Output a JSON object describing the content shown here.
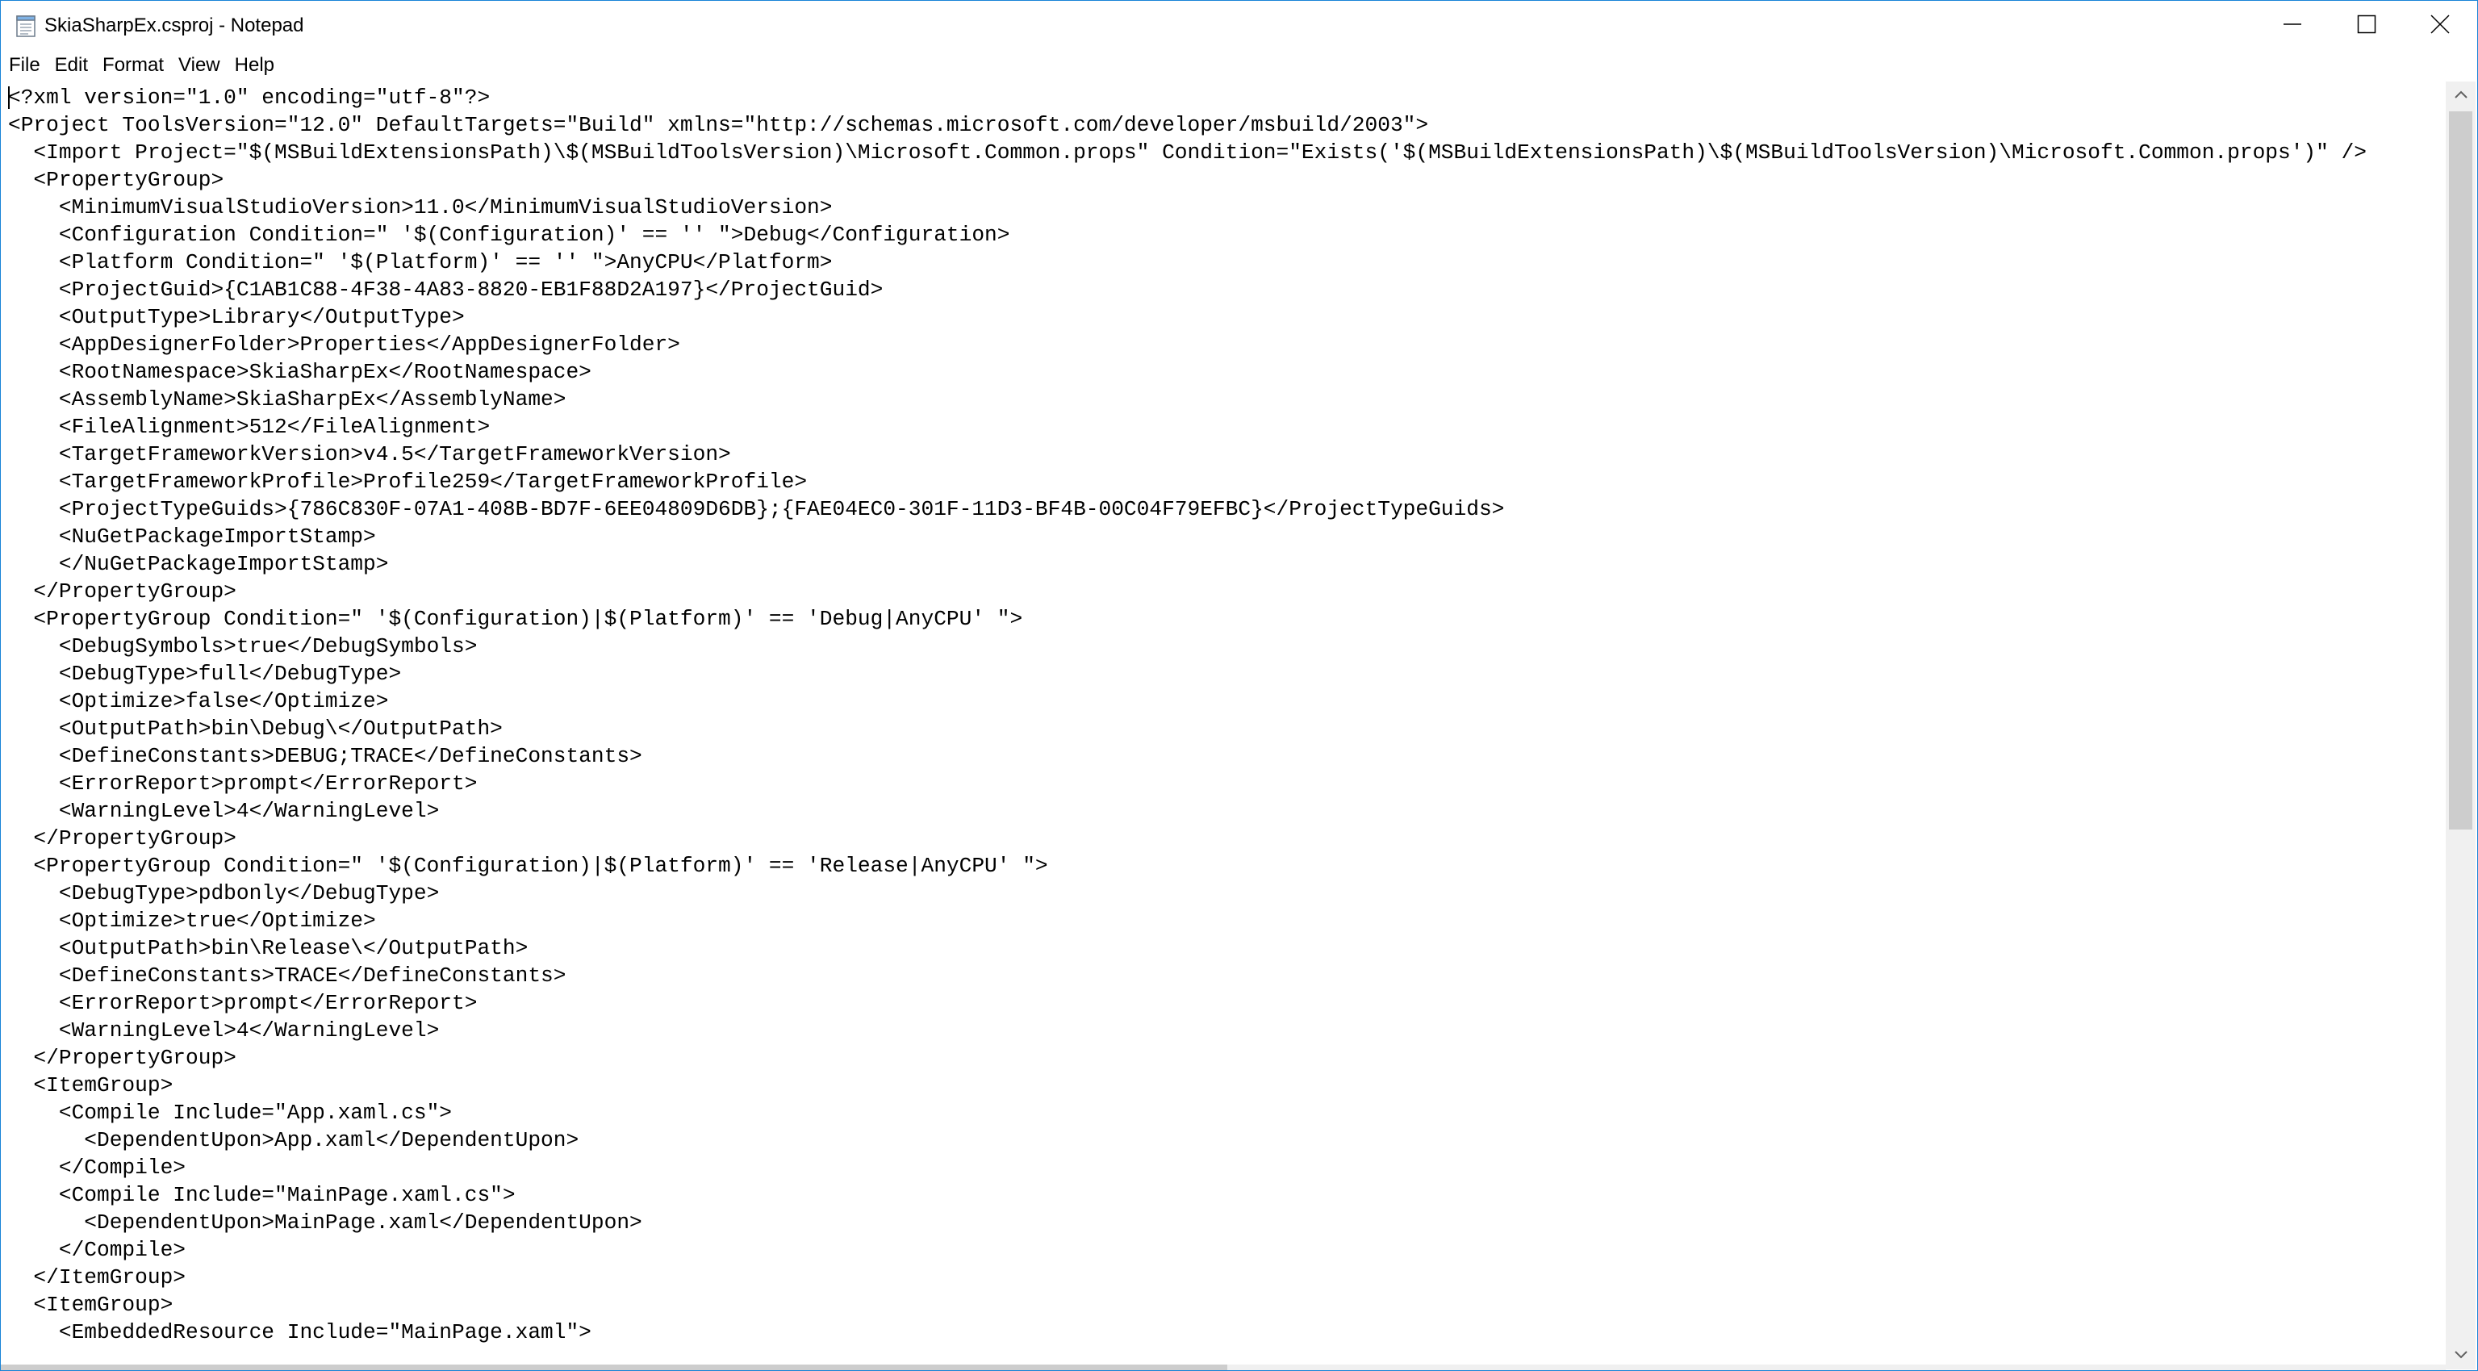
{
  "window": {
    "title": "SkiaSharpEx.csproj - Notepad",
    "app_icon": "notepad-icon",
    "controls": [
      "minimize-icon",
      "maximize-icon",
      "close-icon"
    ]
  },
  "menu": {
    "items": [
      {
        "label": "File"
      },
      {
        "label": "Edit"
      },
      {
        "label": "Format"
      },
      {
        "label": "View"
      },
      {
        "label": "Help"
      }
    ]
  },
  "editor": {
    "lines": [
      "<?xml version=\"1.0\" encoding=\"utf-8\"?>",
      "<Project ToolsVersion=\"12.0\" DefaultTargets=\"Build\" xmlns=\"http://schemas.microsoft.com/developer/msbuild/2003\">",
      "  <Import Project=\"$(MSBuildExtensionsPath)\\$(MSBuildToolsVersion)\\Microsoft.Common.props\" Condition=\"Exists('$(MSBuildExtensionsPath)\\$(MSBuildToolsVersion)\\Microsoft.Common.props')\" />",
      "  <PropertyGroup>",
      "    <MinimumVisualStudioVersion>11.0</MinimumVisualStudioVersion>",
      "    <Configuration Condition=\" '$(Configuration)' == '' \">Debug</Configuration>",
      "    <Platform Condition=\" '$(Platform)' == '' \">AnyCPU</Platform>",
      "    <ProjectGuid>{C1AB1C88-4F38-4A83-8820-EB1F88D2A197}</ProjectGuid>",
      "    <OutputType>Library</OutputType>",
      "    <AppDesignerFolder>Properties</AppDesignerFolder>",
      "    <RootNamespace>SkiaSharpEx</RootNamespace>",
      "    <AssemblyName>SkiaSharpEx</AssemblyName>",
      "    <FileAlignment>512</FileAlignment>",
      "    <TargetFrameworkVersion>v4.5</TargetFrameworkVersion>",
      "    <TargetFrameworkProfile>Profile259</TargetFrameworkProfile>",
      "    <ProjectTypeGuids>{786C830F-07A1-408B-BD7F-6EE04809D6DB};{FAE04EC0-301F-11D3-BF4B-00C04F79EFBC}</ProjectTypeGuids>",
      "    <NuGetPackageImportStamp>",
      "    </NuGetPackageImportStamp>",
      "  </PropertyGroup>",
      "  <PropertyGroup Condition=\" '$(Configuration)|$(Platform)' == 'Debug|AnyCPU' \">",
      "    <DebugSymbols>true</DebugSymbols>",
      "    <DebugType>full</DebugType>",
      "    <Optimize>false</Optimize>",
      "    <OutputPath>bin\\Debug\\</OutputPath>",
      "    <DefineConstants>DEBUG;TRACE</DefineConstants>",
      "    <ErrorReport>prompt</ErrorReport>",
      "    <WarningLevel>4</WarningLevel>",
      "  </PropertyGroup>",
      "  <PropertyGroup Condition=\" '$(Configuration)|$(Platform)' == 'Release|AnyCPU' \">",
      "    <DebugType>pdbonly</DebugType>",
      "    <Optimize>true</Optimize>",
      "    <OutputPath>bin\\Release\\</OutputPath>",
      "    <DefineConstants>TRACE</DefineConstants>",
      "    <ErrorReport>prompt</ErrorReport>",
      "    <WarningLevel>4</WarningLevel>",
      "  </PropertyGroup>",
      "  <ItemGroup>",
      "    <Compile Include=\"App.xaml.cs\">",
      "      <DependentUpon>App.xaml</DependentUpon>",
      "    </Compile>",
      "    <Compile Include=\"MainPage.xaml.cs\">",
      "      <DependentUpon>MainPage.xaml</DependentUpon>",
      "    </Compile>",
      "  </ItemGroup>",
      "  <ItemGroup>",
      "    <EmbeddedResource Include=\"MainPage.xaml\">"
    ]
  },
  "colors": {
    "window_border": "#1883d7",
    "background": "#ffffff",
    "text": "#000000",
    "scrollbar_track": "#f0f0f0",
    "scrollbar_thumb": "#cdcdcd"
  }
}
